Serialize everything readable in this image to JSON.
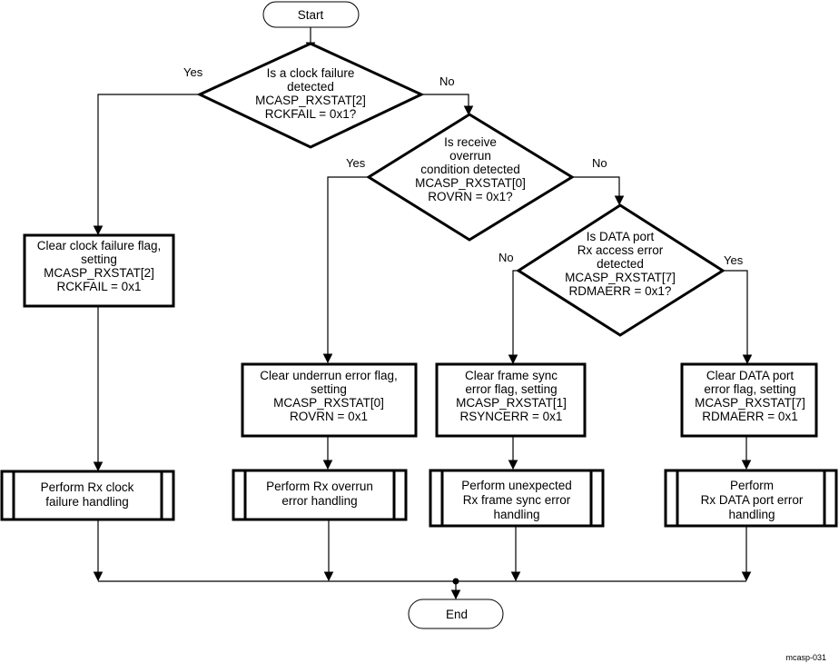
{
  "figure_id": "mcasp-031",
  "terminals": {
    "start": "Start",
    "end": "End"
  },
  "decisions": [
    {
      "id": "clock_failure",
      "lines": [
        "Is a clock failure",
        "detected",
        "MCASP_RXSTAT[2]",
        "RCKFAIL = 0x1?"
      ],
      "yes_label": "Yes",
      "no_label": "No"
    },
    {
      "id": "overrun",
      "lines": [
        "Is receive",
        "overrun",
        "condition detected",
        "MCASP_RXSTAT[0]",
        "ROVRN = 0x1?"
      ],
      "yes_label": "Yes",
      "no_label": "No"
    },
    {
      "id": "data_port",
      "lines": [
        "Is DATA port",
        "Rx access  error",
        "detected",
        "MCASP_RXSTAT[7]",
        "RDMAERR = 0x1?"
      ],
      "yes_label": "Yes",
      "no_label": "No"
    }
  ],
  "processes": [
    {
      "id": "clear_clock",
      "lines": [
        "Clear clock failure flag,",
        "setting",
        "MCASP_RXSTAT[2]",
        "RCKFAIL = 0x1"
      ]
    },
    {
      "id": "clear_overrun",
      "lines": [
        "Clear underrun error flag,",
        "setting",
        "MCASP_RXSTAT[0]",
        "ROVRN = 0x1"
      ]
    },
    {
      "id": "clear_sync",
      "lines": [
        "Clear frame sync",
        "error flag, setting",
        "MCASP_RXSTAT[1]",
        "RSYNCERR = 0x1"
      ]
    },
    {
      "id": "clear_data",
      "lines": [
        "Clear DATA port",
        "error flag, setting",
        "MCASP_RXSTAT[7]",
        "RDMAERR = 0x1"
      ]
    }
  ],
  "subprocesses": [
    {
      "id": "handle_clock",
      "lines": [
        "Perform Rx clock",
        "failure handling"
      ]
    },
    {
      "id": "handle_overrun",
      "lines": [
        "Perform Rx overrun",
        "error handling"
      ]
    },
    {
      "id": "handle_sync",
      "lines": [
        "Perform unexpected",
        "Rx frame sync error",
        "handling"
      ]
    },
    {
      "id": "handle_data",
      "lines": [
        "Perform",
        "Rx DATA port error",
        "handling"
      ]
    }
  ]
}
